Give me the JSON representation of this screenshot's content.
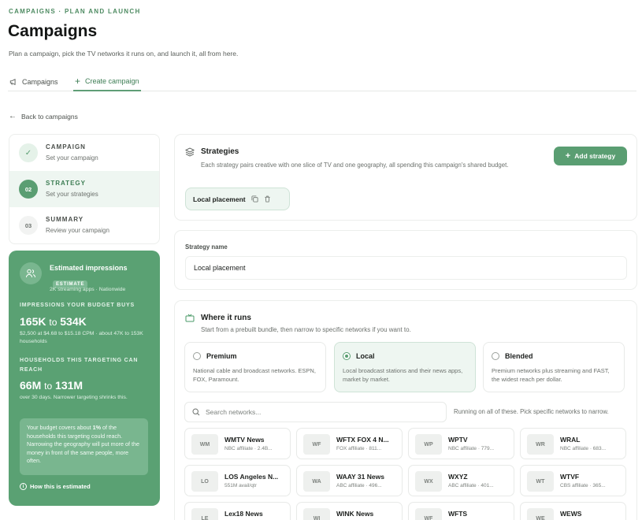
{
  "header": {
    "eyebrow": "CAMPAIGNS · PLAN AND LAUNCH",
    "title": "Campaigns",
    "subtitle": "Plan a campaign, pick the TV networks it runs on, and launch it, all from here."
  },
  "tabs": [
    {
      "label": "Campaigns",
      "icon": "megaphone-icon"
    },
    {
      "label": "Create campaign",
      "icon": "plus-icon"
    }
  ],
  "back_label": "Back to campaigns",
  "steps": [
    {
      "badge": "✓",
      "title": "CAMPAIGN",
      "desc": "Set your campaign",
      "state": "done"
    },
    {
      "badge": "02",
      "title": "STRATEGY",
      "desc": "Set your strategies",
      "state": "active"
    },
    {
      "badge": "03",
      "title": "SUMMARY",
      "desc": "Review your campaign",
      "state": "todo"
    }
  ],
  "impressions": {
    "title": "Estimated impressions",
    "badge": "ESTIMATE",
    "scope": "2K streaming apps · Nationwide",
    "budget_label": "IMPRESSIONS YOUR BUDGET BUYS",
    "budget_low": "165K",
    "budget_to": "to",
    "budget_high": "534K",
    "budget_detail": "$2,500 at $4.68 to $15.18 CPM · about 47K to 153K households",
    "households_label": "HOUSEHOLDS THIS TARGETING CAN REACH",
    "hh_low": "66M",
    "hh_to": "to",
    "hh_high": "131M",
    "hh_detail": "over 30 days. Narrower targeting shrinks this.",
    "coverage_pre": "Your budget covers about ",
    "coverage_pct": "1%",
    "coverage_post": " of the households this targeting could reach. Narrowing the geography will put more of the money in front of the same people, more often.",
    "how_label": "How this is estimated"
  },
  "strategies": {
    "title": "Strategies",
    "desc": "Each strategy pairs creative with one slice of TV and one geography, all spending this campaign's shared budget.",
    "add_label": "Add strategy",
    "chip_label": "Local placement"
  },
  "strategy_name": {
    "label": "Strategy name",
    "value": "Local placement"
  },
  "where": {
    "title": "Where it runs",
    "desc": "Start from a prebuilt bundle, then narrow to specific networks if you want to.",
    "options": [
      {
        "name": "Premium",
        "desc": "National cable and broadcast networks. ESPN, FOX, Paramount.",
        "selected": false
      },
      {
        "name": "Local",
        "desc": "Local broadcast stations and their news apps, market by market.",
        "selected": true
      },
      {
        "name": "Blended",
        "desc": "Premium networks plus streaming and FAST, the widest reach per dollar.",
        "selected": false
      }
    ],
    "search_placeholder": "Search networks...",
    "hint": "Running on all of these. Pick specific networks to narrow."
  },
  "networks": [
    {
      "abbr": "WM",
      "name": "WMTV News",
      "desc": "NBC affiliate · 2.4B..."
    },
    {
      "abbr": "WF",
      "name": "WFTX FOX 4 N...",
      "desc": "FOX affiliate · 811..."
    },
    {
      "abbr": "WP",
      "name": "WPTV",
      "desc": "NBC affiliate · 779..."
    },
    {
      "abbr": "WR",
      "name": "WRAL",
      "desc": "NBC affiliate · 683..."
    },
    {
      "abbr": "LO",
      "name": "LOS Angeles N...",
      "desc": "551M avail/qtr"
    },
    {
      "abbr": "WA",
      "name": "WAAY 31 News",
      "desc": "ABC affiliate · 496..."
    },
    {
      "abbr": "WX",
      "name": "WXYZ",
      "desc": "ABC affiliate · 401..."
    },
    {
      "abbr": "WT",
      "name": "WTVF",
      "desc": "CBS affiliate · 365..."
    },
    {
      "abbr": "LE",
      "name": "Lex18 News",
      "desc": ""
    },
    {
      "abbr": "WI",
      "name": "WINK News",
      "desc": ""
    },
    {
      "abbr": "WF",
      "name": "WFTS",
      "desc": ""
    },
    {
      "abbr": "WE",
      "name": "WEWS",
      "desc": ""
    }
  ],
  "colors": {
    "accent": "#5a9e72",
    "panel": "#5aa173"
  }
}
